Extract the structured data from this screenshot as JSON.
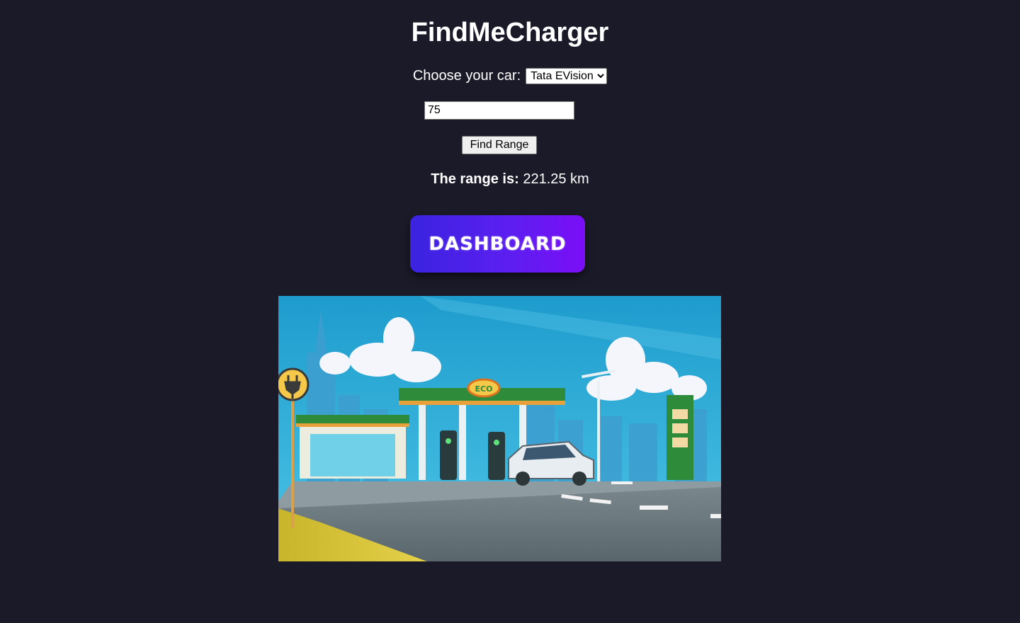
{
  "header": {
    "title": "FindMeCharger"
  },
  "form": {
    "car_label": "Choose your car:",
    "car_selected": "Tata EVision",
    "charge_value": "75",
    "find_button": "Find Range"
  },
  "result": {
    "label": "The range is:",
    "value": "221.25 km"
  },
  "dashboard_button": "DASHBOARD",
  "illustration": {
    "station_sign": "ECO",
    "colors": {
      "sky": "#2fa9d6",
      "road": "#6b7a80",
      "grass": "#d8c23a",
      "station_green": "#2e8b3a"
    }
  }
}
